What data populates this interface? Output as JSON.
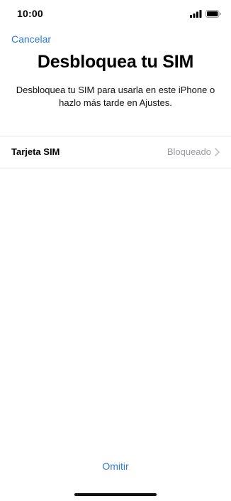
{
  "status_bar": {
    "time": "10:00",
    "signal_icon": "cellular-signal-icon",
    "battery_icon": "battery-full-icon"
  },
  "header": {
    "cancel_label": "Cancelar"
  },
  "main": {
    "title": "Desbloquea tu SIM",
    "description": "Desbloquea tu SIM para usarla en este iPhone o hazlo más tarde en Ajustes."
  },
  "sim_row": {
    "label": "Tarjeta SIM",
    "value": "Bloqueado",
    "chevron_icon": "chevron-right-icon"
  },
  "footer": {
    "skip_label": "Omitir"
  },
  "colors": {
    "accent": "#2f7bd6",
    "secondary_text": "#9a9a9f",
    "separator": "#e4e4e6"
  }
}
